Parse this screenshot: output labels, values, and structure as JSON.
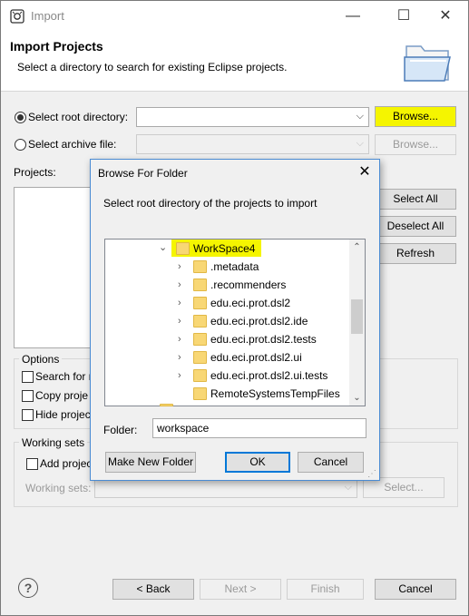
{
  "window": {
    "title": "Import",
    "heading": "Import Projects",
    "subtitle": "Select a directory to search for existing Eclipse projects.",
    "minimize": "—",
    "maximize": "☐",
    "close": "✕"
  },
  "source": {
    "root_label": "Select root directory:",
    "root_value": "",
    "archive_label": "Select archive file:",
    "archive_value": "",
    "browse_root": "Browse...",
    "browse_archive": "Browse...",
    "highlight_color": "#f5f500"
  },
  "projects": {
    "label": "Projects:",
    "select_all": "Select All",
    "deselect_all": "Deselect All",
    "refresh": "Refresh"
  },
  "options": {
    "title": "Options",
    "search_nested": "Search for n",
    "copy_projects": "Copy proje",
    "hide_projects": "Hide projec"
  },
  "working_sets": {
    "title": "Working sets",
    "add_project": "Add projec",
    "label": "Working sets:",
    "select": "Select..."
  },
  "footer": {
    "help": "?",
    "back": "< Back",
    "next": "Next >",
    "finish": "Finish",
    "cancel": "Cancel"
  },
  "dialog": {
    "title": "Browse For Folder",
    "close": "✕",
    "description": "Select root directory of the projects to import",
    "tree": {
      "root": "WorkSpace4",
      "children": [
        ".metadata",
        ".recommenders",
        "edu.eci.prot.dsl2",
        "edu.eci.prot.dsl2.ide",
        "edu.eci.prot.dsl2.tests",
        "edu.eci.prot.dsl2.ui",
        "edu.eci.prot.dsl2.ui.tests",
        "RemoteSystemsTempFiles"
      ]
    },
    "folder_label": "Folder:",
    "folder_value": "workspace",
    "make_new_folder": "Make New Folder",
    "ok": "OK",
    "cancel": "Cancel"
  }
}
